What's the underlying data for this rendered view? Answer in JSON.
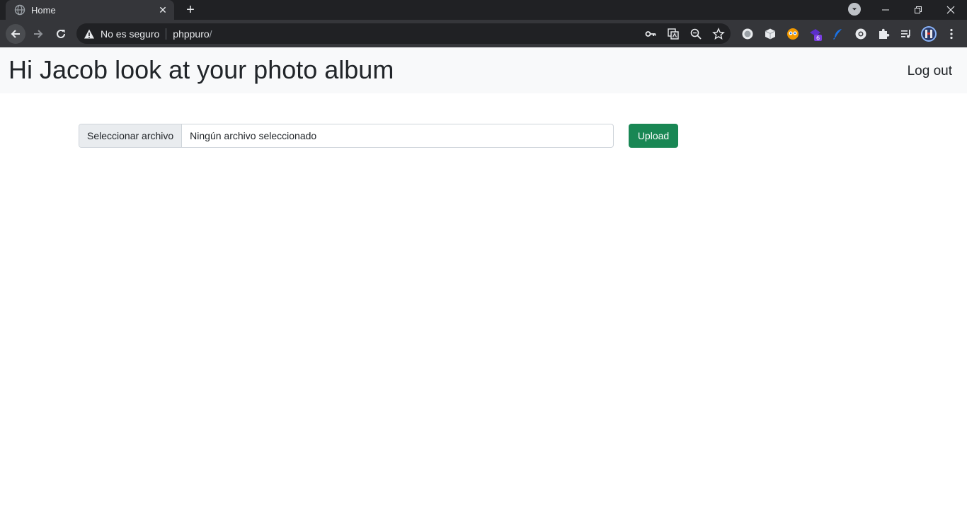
{
  "browser": {
    "tab": {
      "title": "Home",
      "favicon": "globe-icon",
      "close_glyph": "✕"
    },
    "new_tab_glyph": "+",
    "window_controls": {
      "minimize": "—",
      "maximize": "❐",
      "close": "✕"
    },
    "omnibox": {
      "security_label": "No es seguro",
      "url_host": "phppuro",
      "url_path": "/"
    },
    "omnibox_icons": [
      "key-icon",
      "translate-icon",
      "zoom-icon",
      "star-icon"
    ],
    "extensions": [
      {
        "name": "extension-circle-icon",
        "color": "#e8eaed"
      },
      {
        "name": "extension-cube-icon",
        "color": "#e8eaed"
      },
      {
        "name": "extension-eyes-icon",
        "color": "#f29900"
      },
      {
        "name": "extension-purple-icon",
        "color": "#7b3fe4",
        "badge": "6"
      },
      {
        "name": "extension-feather-icon",
        "color": "#1a73e8"
      },
      {
        "name": "extension-ring-icon",
        "color": "#e8eaed"
      },
      {
        "name": "extensions-puzzle-icon",
        "color": "#e8eaed"
      },
      {
        "name": "media-queue-icon",
        "color": "#e8eaed"
      },
      {
        "name": "profile-avatar",
        "color": "#8ab4f8"
      },
      {
        "name": "kebab-menu-icon",
        "color": "#e8eaed"
      }
    ]
  },
  "page": {
    "title": "Hi Jacob look at your photo album",
    "logout_label": "Log out",
    "file_input": {
      "button_label": "Seleccionar archivo",
      "status_text": "Ningún archivo seleccionado"
    },
    "upload_label": "Upload",
    "colors": {
      "navbar_bg": "#f8f9fa",
      "upload_bg": "#198754"
    }
  }
}
